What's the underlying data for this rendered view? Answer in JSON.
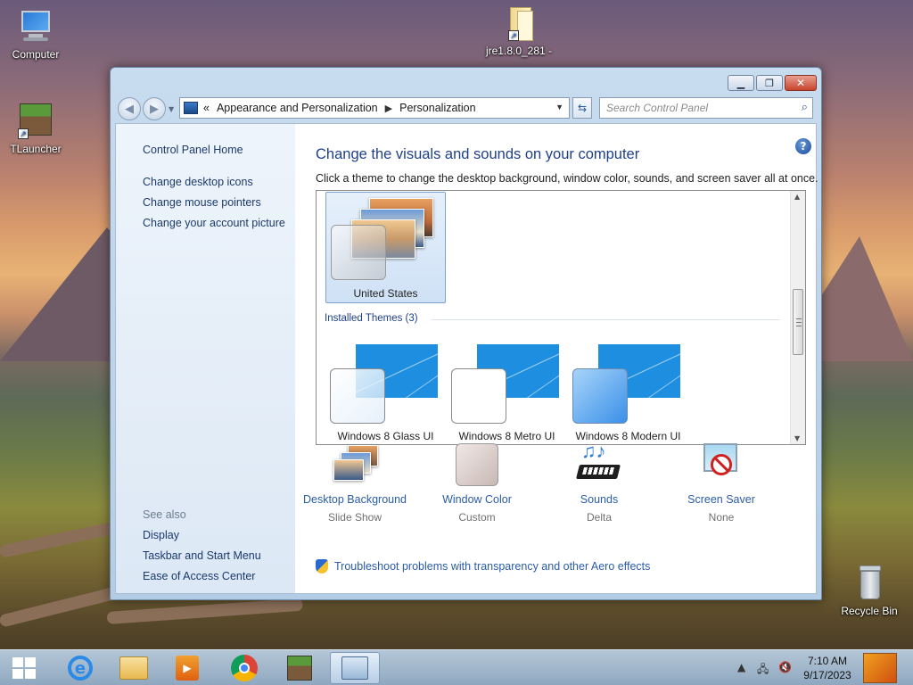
{
  "desktop": {
    "icons": [
      {
        "label": "Computer",
        "icon": "computer-icon"
      },
      {
        "label": "TLauncher",
        "icon": "tlauncher-icon"
      },
      {
        "label": "jre1.8.0_281 -",
        "icon": "folder-shortcut-icon"
      },
      {
        "label": "Recycle Bin",
        "icon": "recycle-bin-icon"
      }
    ]
  },
  "window": {
    "address": {
      "overflow": "«",
      "crumbs": [
        "Appearance and Personalization",
        "Personalization"
      ]
    },
    "search": {
      "placeholder": "Search Control Panel"
    },
    "sidebar": {
      "home": "Control Panel Home",
      "links": [
        "Change desktop icons",
        "Change mouse pointers",
        "Change your account picture"
      ],
      "see_also": "See also",
      "see_also_links": [
        "Display",
        "Taskbar and Start Menu",
        "Ease of Access Center"
      ]
    },
    "main": {
      "title": "Change the visuals and sounds on your computer",
      "description": "Click a theme to change the desktop background, window color, sounds, and screen saver all at once.",
      "current_theme": "United States",
      "installed_header": "Installed Themes (3)",
      "installed_themes": [
        "Windows 8 Glass UI",
        "Windows 8 Metro UI",
        "Windows 8 Modern UI"
      ],
      "tools": [
        {
          "name": "Desktop Background",
          "value": "Slide Show",
          "icon": "desktop-background-icon"
        },
        {
          "name": "Window Color",
          "value": "Custom",
          "icon": "window-color-icon"
        },
        {
          "name": "Sounds",
          "value": "Delta",
          "icon": "sounds-icon"
        },
        {
          "name": "Screen Saver",
          "value": "None",
          "icon": "screen-saver-icon"
        }
      ],
      "troubleshoot": "Troubleshoot problems with transparency and other Aero effects"
    }
  },
  "taskbar": {
    "items": [
      "start-icon",
      "internet-explorer-icon",
      "file-explorer-icon",
      "media-player-icon",
      "chrome-icon",
      "minecraft-icon",
      "control-panel-icon"
    ],
    "time": "7:10 AM",
    "date": "9/17/2023"
  },
  "colors": {
    "link": "#2a5ca8",
    "title": "#1e3f8a",
    "taskbar": "#a8c0da",
    "win8_blue": "#1e8fe0"
  }
}
